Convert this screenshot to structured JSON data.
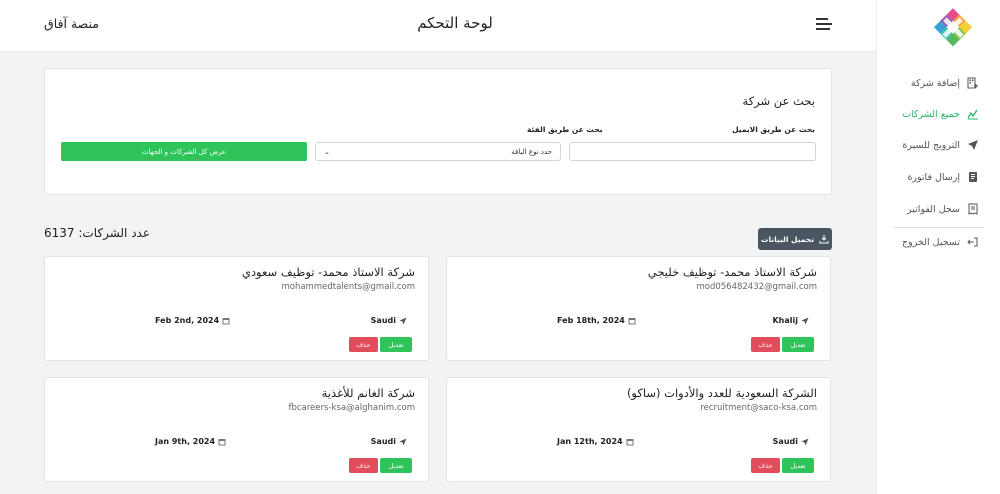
{
  "header": {
    "platform_name": "منصة آفاق",
    "page_title": "لوحة التحكم"
  },
  "sidebar": {
    "items": [
      {
        "label": "إضافة شركة",
        "icon": "building-add-icon"
      },
      {
        "label": "جميع الشركات",
        "icon": "chart-line-icon"
      },
      {
        "label": "الترويج للسيرة",
        "icon": "send-icon"
      },
      {
        "label": "إرسال فاتورة",
        "icon": "invoice-icon"
      },
      {
        "label": "سجل الفواتير",
        "icon": "receipt-icon"
      },
      {
        "label": "تسجيل الخروج",
        "icon": "logout-icon"
      }
    ],
    "active_index": 1
  },
  "search": {
    "title": "بحث عن شركة",
    "email_label": "بحث عن طريق الايميل",
    "email_value": "",
    "category_label": "بحث عن طريق الفئة",
    "category_selected": "حدد نوع الباقة",
    "show_all_button": "عرض كل الشركات و الجهات"
  },
  "summary": {
    "count_text": "عدد الشركات: 6137",
    "download_button": "تحميل البيانات"
  },
  "companies": [
    {
      "name": "شركة الاستاذ محمد- توظيف خليجي",
      "email": "mod056482432@gmail.com",
      "location": "Khalij",
      "date": "Feb 18th, 2024"
    },
    {
      "name": "شركة الاستاذ محمد- توظيف سعودي",
      "email": "mohammedtalents@gmail.com",
      "location": "Saudi",
      "date": "Feb 2nd, 2024"
    },
    {
      "name": "الشركة السعودية للعدد والأدوات (ساكو)",
      "email": "recruitment@saco-ksa.com",
      "location": "Saudi",
      "date": "Jan 12th, 2024"
    },
    {
      "name": "شركة الغانم للأغذية",
      "email": "fbcareers-ksa@alghanim.com",
      "location": "Saudi",
      "date": "Jan 9th, 2024"
    }
  ],
  "card_actions": {
    "edit": "تعديل",
    "delete": "حذف"
  },
  "colors": {
    "accent_green": "#2ec45a",
    "danger_red": "#e14d5a",
    "dark_button": "#4a5561"
  }
}
